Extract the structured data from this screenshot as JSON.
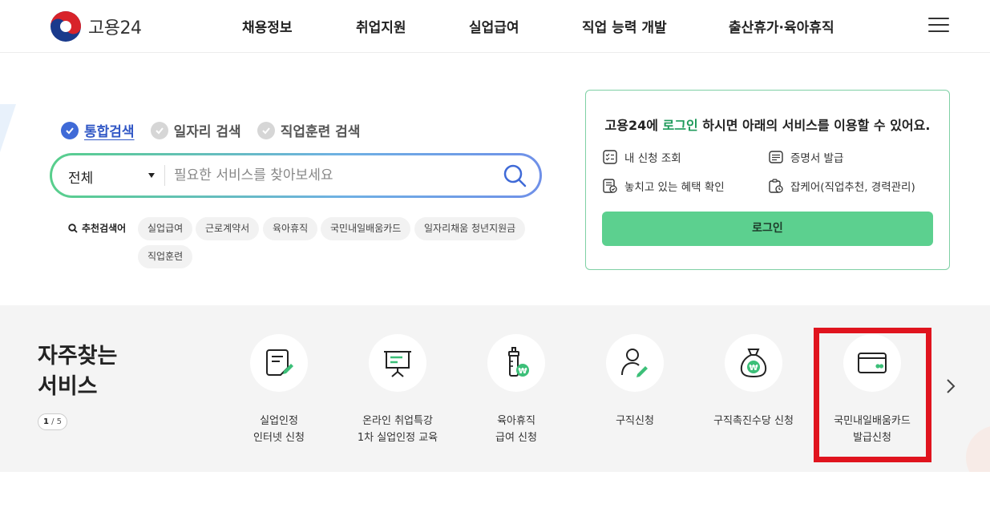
{
  "header": {
    "logo_text": "고용24",
    "nav": [
      {
        "label": "채용정보"
      },
      {
        "label": "취업지원"
      },
      {
        "label": "실업급여"
      },
      {
        "label": "직업 능력 개발"
      },
      {
        "label": "출산휴가·육아휴직"
      }
    ],
    "menu_icon": "hamburger-icon"
  },
  "search": {
    "tabs": [
      {
        "label": "통합검색",
        "active": true
      },
      {
        "label": "일자리 검색",
        "active": false
      },
      {
        "label": "직업훈련 검색",
        "active": false
      }
    ],
    "select_value": "전체",
    "placeholder": "필요한 서비스를 찾아보세요",
    "keywords_label": "추천검색어",
    "keywords": [
      "실업급여",
      "근로계약서",
      "육아휴직",
      "국민내일배움카드",
      "일자리채움 청년지원금",
      "직업훈련"
    ]
  },
  "login_box": {
    "title_prefix": "고용24에 ",
    "title_highlight": "로그인",
    "title_suffix": " 하시면 아래의 서비스를 이용할 수 있어요.",
    "items": [
      {
        "label": "내 신청 조회",
        "icon": "checklist-icon"
      },
      {
        "label": "증명서 발급",
        "icon": "certificate-icon"
      },
      {
        "label": "놓치고 있는 혜택 확인",
        "icon": "benefit-check-icon"
      },
      {
        "label": "잡케어(직업추천, 경력관리)",
        "icon": "jobcare-icon"
      }
    ],
    "button_label": "로그인"
  },
  "services": {
    "title_line1": "자주찾는",
    "title_line2": "서비스",
    "pager_current": "1",
    "pager_total": "5",
    "items": [
      {
        "label": "실업인정\n인터넷 신청",
        "icon": "document-pen-icon"
      },
      {
        "label": "온라인 취업특강\n1차 실업인정 교육",
        "icon": "presentation-board-icon"
      },
      {
        "label": "육아휴직\n급여 신청",
        "icon": "baby-bottle-won-icon"
      },
      {
        "label": "구직신청",
        "icon": "person-pen-icon"
      },
      {
        "label": "구직촉진수당 신청",
        "icon": "money-bag-won-icon"
      },
      {
        "label": "국민내일배움카드\n발급신청",
        "icon": "card-icon",
        "highlighted": true
      }
    ],
    "next_icon": "chevron-right-icon"
  },
  "colors": {
    "brand_green": "#5cd08f",
    "active_blue": "#3f6ad7",
    "highlight_red": "#e0141e"
  }
}
